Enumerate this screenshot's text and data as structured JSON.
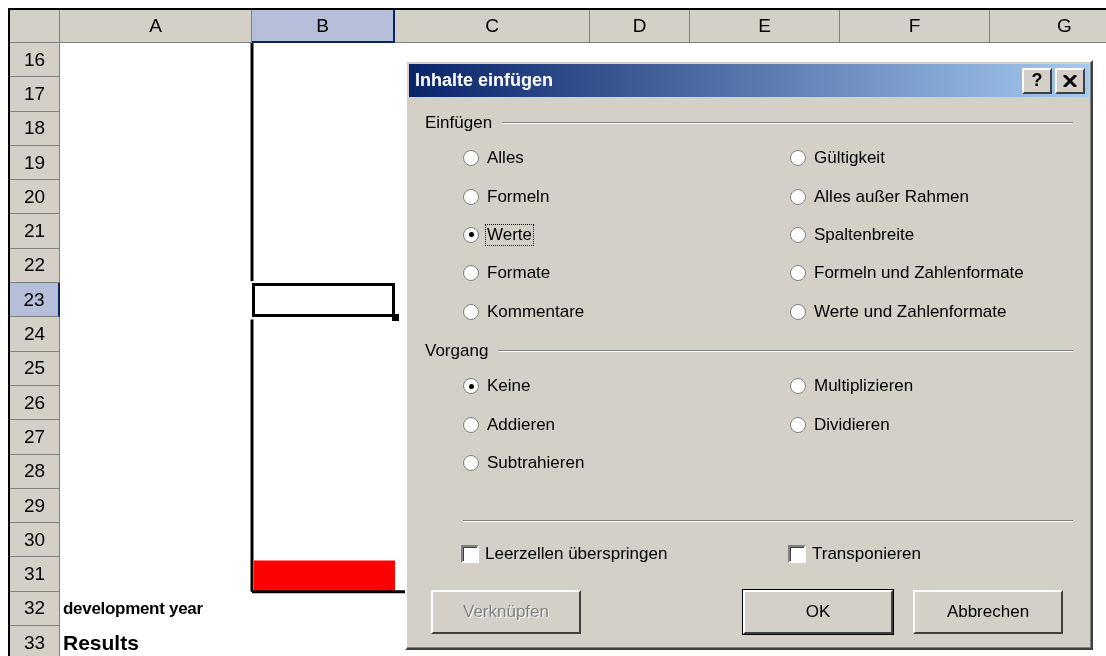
{
  "sheet": {
    "columns": [
      {
        "label": "A",
        "selected": false
      },
      {
        "label": "B",
        "selected": true
      },
      {
        "label": "C",
        "selected": false
      },
      {
        "label": "D",
        "selected": false
      },
      {
        "label": "E",
        "selected": false
      },
      {
        "label": "F",
        "selected": false
      },
      {
        "label": "G",
        "selected": false
      }
    ],
    "rows": [
      {
        "number": "16",
        "selected": false
      },
      {
        "number": "17",
        "selected": false
      },
      {
        "number": "18",
        "selected": false
      },
      {
        "number": "19",
        "selected": false
      },
      {
        "number": "20",
        "selected": false
      },
      {
        "number": "21",
        "selected": false
      },
      {
        "number": "22",
        "selected": false
      },
      {
        "number": "23",
        "selected": true
      },
      {
        "number": "24",
        "selected": false
      },
      {
        "number": "25",
        "selected": false
      },
      {
        "number": "26",
        "selected": false
      },
      {
        "number": "27",
        "selected": false
      },
      {
        "number": "28",
        "selected": false
      },
      {
        "number": "29",
        "selected": false
      },
      {
        "number": "30",
        "selected": false
      },
      {
        "number": "31",
        "selected": false
      },
      {
        "number": "32",
        "selected": false,
        "cells": [
          {
            "text": "development year",
            "kind": "label"
          }
        ]
      },
      {
        "number": "33",
        "selected": false,
        "cells": [
          {
            "text": "Results",
            "kind": "heading"
          }
        ]
      }
    ]
  },
  "dialog": {
    "title": "Inhalte einfügen",
    "help_button": "?",
    "groups": [
      {
        "title": "Einfügen",
        "options": [
          {
            "label": "Alles",
            "selected": false,
            "focused": false
          },
          {
            "label": "Gültigkeit",
            "selected": false,
            "focused": false
          },
          {
            "label": "Formeln",
            "selected": false,
            "focused": false
          },
          {
            "label": "Alles außer Rahmen",
            "selected": false,
            "focused": false
          },
          {
            "label": "Werte",
            "selected": true,
            "focused": true
          },
          {
            "label": "Spaltenbreite",
            "selected": false,
            "focused": false
          },
          {
            "label": "Formate",
            "selected": false,
            "focused": false
          },
          {
            "label": "Formeln und Zahlenformate",
            "selected": false,
            "focused": false
          },
          {
            "label": "Kommentare",
            "selected": false,
            "focused": false
          },
          {
            "label": "Werte und Zahlenformate",
            "selected": false,
            "focused": false
          }
        ]
      },
      {
        "title": "Vorgang",
        "options": [
          {
            "label": "Keine",
            "selected": true,
            "focused": false
          },
          {
            "label": "Multiplizieren",
            "selected": false,
            "focused": false
          },
          {
            "label": "Addieren",
            "selected": false,
            "focused": false
          },
          {
            "label": "Dividieren",
            "selected": false,
            "focused": false
          },
          {
            "label": "Subtrahieren",
            "selected": false,
            "focused": false
          }
        ]
      }
    ],
    "checkboxes": [
      {
        "label": "Leerzellen überspringen",
        "checked": false
      },
      {
        "label": "Transponieren",
        "checked": false
      }
    ],
    "buttons": [
      {
        "label": "Verknüpfen",
        "disabled": true,
        "default": false
      },
      {
        "label": "OK",
        "disabled": false,
        "default": true
      },
      {
        "label": "Abbrechen",
        "disabled": false,
        "default": false
      }
    ]
  }
}
